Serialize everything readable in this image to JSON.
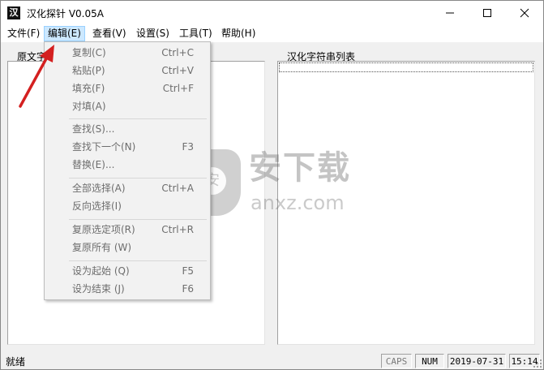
{
  "window": {
    "title": "汉化探针  V0.05A",
    "icon": "app-logo-icon"
  },
  "menu": [
    {
      "label": "文件(F)"
    },
    {
      "label": "编辑(E)",
      "active": true
    },
    {
      "label": "查看(V)"
    },
    {
      "label": "设置(S)"
    },
    {
      "label": "工具(T)"
    },
    {
      "label": "帮助(H)"
    }
  ],
  "panels": {
    "left_label": "原文字",
    "right_label": "汉化字符串列表"
  },
  "edit_menu": {
    "items": [
      {
        "label": "复制(C)",
        "shortcut": "Ctrl+C"
      },
      {
        "label": "粘贴(P)",
        "shortcut": "Ctrl+V"
      },
      {
        "label": "填充(F)",
        "shortcut": "Ctrl+F"
      },
      {
        "label": "对填(A)",
        "shortcut": ""
      },
      {
        "label": "查找(S)...",
        "shortcut": ""
      },
      {
        "label": "查找下一个(N)",
        "shortcut": "F3"
      },
      {
        "label": "替换(E)...",
        "shortcut": ""
      },
      {
        "label": "全部选择(A)",
        "shortcut": "Ctrl+A"
      },
      {
        "label": "反向选择(I)",
        "shortcut": ""
      },
      {
        "label": "复原选定项(R)",
        "shortcut": "Ctrl+R"
      },
      {
        "label": "复原所有  (W)",
        "shortcut": ""
      },
      {
        "label": "设为起始  (Q)",
        "shortcut": "F5"
      },
      {
        "label": "设为结束  (J)",
        "shortcut": "F6"
      }
    ]
  },
  "watermark": {
    "cn": "安下载",
    "en": "anxz.com",
    "shield_glyph": "安"
  },
  "status": {
    "text": "就绪",
    "caps": "CAPS",
    "num": "NUM",
    "date": "2019-07-31",
    "time": "15:14"
  },
  "colors": {
    "menu_highlight": "#cce8ff",
    "arrow": "#d42020",
    "disabled_text": "#6d6d6d"
  }
}
